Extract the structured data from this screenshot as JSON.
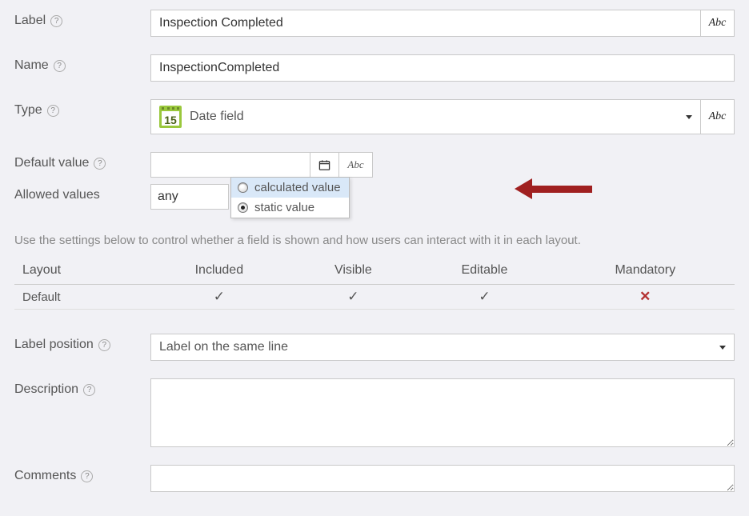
{
  "fields": {
    "label_label": "Label",
    "label_value": "Inspection Completed",
    "name_label": "Name",
    "name_value": "InspectionCompleted",
    "type_label": "Type",
    "type_value": "Date field",
    "type_icon_day": "15",
    "default_label": "Default value",
    "default_value": "",
    "allowed_label": "Allowed values",
    "allowed_value": "any",
    "label_position_label": "Label position",
    "label_position_value": "Label on the same line",
    "description_label": "Description",
    "description_value": "",
    "comments_label": "Comments",
    "comments_value": "",
    "abc": "Abc"
  },
  "popup": {
    "opt1": "calculated value",
    "opt2": "static value"
  },
  "hint": "Use the settings below to control whether a field is shown and how users can interact with it in each layout.",
  "table": {
    "h1": "Layout",
    "h2": "Included",
    "h3": "Visible",
    "h4": "Editable",
    "h5": "Mandatory",
    "row1": "Default"
  }
}
